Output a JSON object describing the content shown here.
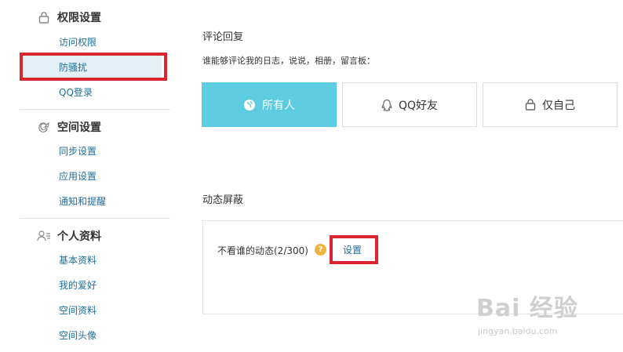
{
  "sidebar": {
    "sections": [
      {
        "title": "权限设置",
        "icon": "lock-icon",
        "items": [
          "访问权限",
          "防骚扰",
          "QQ登录"
        ]
      },
      {
        "title": "空间设置",
        "icon": "space-icon",
        "items": [
          "同步设置",
          "应用设置",
          "通知和提醒"
        ]
      },
      {
        "title": "个人资料",
        "icon": "profile-icon",
        "items": [
          "基本资料",
          "我的爱好",
          "空间资料",
          "空间头像"
        ]
      }
    ],
    "active_item": "防骚扰"
  },
  "comment": {
    "title": "评论回复",
    "question": "谁能够评论我的日志，说说，相册，留言板：",
    "options": [
      {
        "label": "所有人",
        "icon": "globe-icon",
        "selected": true
      },
      {
        "label": "QQ好友",
        "icon": "qq-icon",
        "selected": false
      },
      {
        "label": "仅自己",
        "icon": "lock-icon",
        "selected": false
      }
    ]
  },
  "mask": {
    "title": "动态屏蔽",
    "label": "不看谁的动态(2/300)",
    "help": "?",
    "link": "设置"
  },
  "watermark": {
    "main": "Bai 经验",
    "sub": "jingyan.baidu.com"
  },
  "colors": {
    "accent": "#5dcbe0",
    "link": "#1e6e9a",
    "highlight": "#d9262f"
  }
}
